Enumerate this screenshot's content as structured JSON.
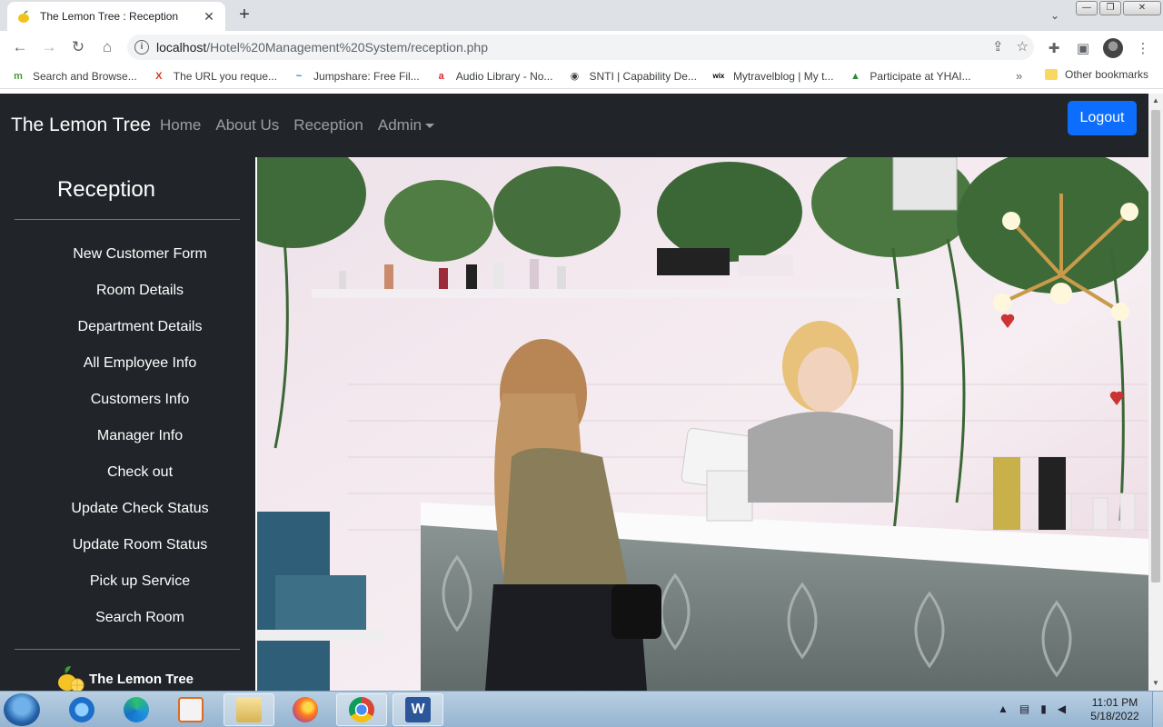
{
  "browser": {
    "tab_title": "The Lemon Tree : Reception",
    "url_host": "localhost",
    "url_path": "/Hotel%20Management%20System/reception.php",
    "bookmarks": [
      {
        "label": "Search and Browse...",
        "icon": "ms-icon",
        "color": "#4a9b3c"
      },
      {
        "label": "The URL you reque...",
        "icon": "x-icon",
        "color": "#d9361f"
      },
      {
        "label": "Jumpshare: Free Fil...",
        "icon": "jumpshare-icon",
        "color": "#2a7bd1"
      },
      {
        "label": "Audio Library - No...",
        "icon": "audio-library-icon",
        "color": "#d7262d"
      },
      {
        "label": "SNTI | Capability De...",
        "icon": "globe-icon",
        "color": "#444444"
      },
      {
        "label": "Mytravelblog | My t...",
        "icon": "wix-icon",
        "color": "#000000"
      },
      {
        "label": "Participate at YHAI...",
        "icon": "yhai-icon",
        "color": "#2e8b3e"
      }
    ],
    "other_bookmarks": "Other bookmarks",
    "more": "»"
  },
  "navbar": {
    "brand": "The Lemon Tree",
    "links": [
      "Home",
      "About Us",
      "Reception"
    ],
    "admin": "Admin",
    "logout": "Logout"
  },
  "sidebar": {
    "title": "Reception",
    "items": [
      "New Customer Form",
      "Room Details",
      "Department Details",
      "All Employee Info",
      "Customers Info",
      "Manager Info",
      "Check out",
      "Update Check Status",
      "Update Room Status",
      "Pick up Service",
      "Search Room"
    ],
    "footer_brand": "The Lemon Tree"
  },
  "taskbar": {
    "time": "11:01 PM",
    "date": "5/18/2022"
  },
  "colors": {
    "page_bg": "#212529",
    "primary": "#0d6efd"
  }
}
